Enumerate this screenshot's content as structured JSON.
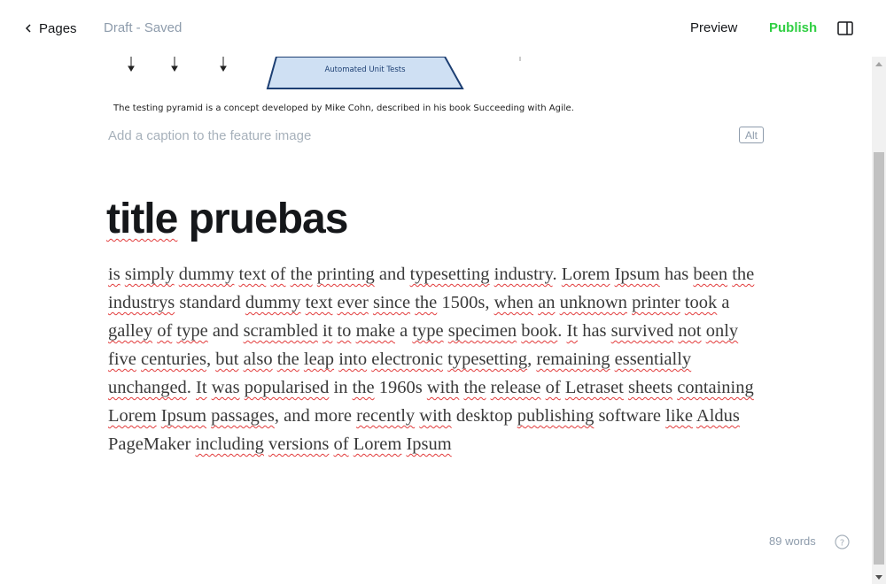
{
  "header": {
    "back_label": "Pages",
    "status": "Draft - Saved",
    "preview_label": "Preview",
    "publish_label": "Publish"
  },
  "feature_image": {
    "alt_text_image_box_label": "Automated Unit Tests",
    "caption_text": "The testing pyramid is a concept developed by Mike Cohn, described in his book Succeeding with Agile.",
    "caption_placeholder": "Add a caption to the feature image",
    "alt_label": "Alt"
  },
  "post": {
    "title_word": "title",
    "title_rest": " pruebas",
    "body_segments": [
      {
        "t": "is",
        "s": true
      },
      {
        "t": " "
      },
      {
        "t": "simply",
        "s": true
      },
      {
        "t": " "
      },
      {
        "t": "dummy",
        "s": true
      },
      {
        "t": " "
      },
      {
        "t": "text",
        "s": true
      },
      {
        "t": " "
      },
      {
        "t": "of",
        "s": true
      },
      {
        "t": " "
      },
      {
        "t": "the",
        "s": true
      },
      {
        "t": " "
      },
      {
        "t": "printing",
        "s": true
      },
      {
        "t": " and "
      },
      {
        "t": "typesetting",
        "s": true
      },
      {
        "t": " "
      },
      {
        "t": "industry",
        "s": true
      },
      {
        "t": ". "
      },
      {
        "t": "Lorem",
        "s": true
      },
      {
        "t": " "
      },
      {
        "t": "Ipsum",
        "s": true
      },
      {
        "t": " has "
      },
      {
        "t": "been",
        "s": true
      },
      {
        "t": " "
      },
      {
        "t": "the",
        "s": true
      },
      {
        "t": " "
      },
      {
        "t": "industrys",
        "s": true
      },
      {
        "t": " standard "
      },
      {
        "t": "dummy",
        "s": true
      },
      {
        "t": " "
      },
      {
        "t": "text",
        "s": true
      },
      {
        "t": " "
      },
      {
        "t": "ever",
        "s": true
      },
      {
        "t": " "
      },
      {
        "t": "since",
        "s": true
      },
      {
        "t": " "
      },
      {
        "t": "the",
        "s": true
      },
      {
        "t": " 1500s, "
      },
      {
        "t": "when",
        "s": true
      },
      {
        "t": " "
      },
      {
        "t": "an",
        "s": true
      },
      {
        "t": " "
      },
      {
        "t": "unknown",
        "s": true
      },
      {
        "t": " "
      },
      {
        "t": "printer",
        "s": true
      },
      {
        "t": " "
      },
      {
        "t": "took",
        "s": true
      },
      {
        "t": " a "
      },
      {
        "t": "galley",
        "s": true
      },
      {
        "t": " "
      },
      {
        "t": "of",
        "s": true
      },
      {
        "t": " "
      },
      {
        "t": "type",
        "s": true
      },
      {
        "t": " and "
      },
      {
        "t": "scrambled",
        "s": true
      },
      {
        "t": " "
      },
      {
        "t": "it",
        "s": true
      },
      {
        "t": " "
      },
      {
        "t": "to",
        "s": true
      },
      {
        "t": " "
      },
      {
        "t": "make",
        "s": true
      },
      {
        "t": " a "
      },
      {
        "t": "type",
        "s": true
      },
      {
        "t": " "
      },
      {
        "t": "specimen",
        "s": true
      },
      {
        "t": " "
      },
      {
        "t": "book",
        "s": true
      },
      {
        "t": ". "
      },
      {
        "t": "It",
        "s": true
      },
      {
        "t": " has "
      },
      {
        "t": "survived",
        "s": true
      },
      {
        "t": " "
      },
      {
        "t": "not",
        "s": true
      },
      {
        "t": " "
      },
      {
        "t": "only",
        "s": true
      },
      {
        "t": " "
      },
      {
        "t": "five",
        "s": true
      },
      {
        "t": " "
      },
      {
        "t": "centuries",
        "s": true
      },
      {
        "t": ", "
      },
      {
        "t": "but",
        "s": true
      },
      {
        "t": " "
      },
      {
        "t": "also",
        "s": true
      },
      {
        "t": " "
      },
      {
        "t": "the",
        "s": true
      },
      {
        "t": " "
      },
      {
        "t": "leap",
        "s": true
      },
      {
        "t": " "
      },
      {
        "t": "into",
        "s": true
      },
      {
        "t": " "
      },
      {
        "t": "electronic",
        "s": true
      },
      {
        "t": " "
      },
      {
        "t": "typesetting",
        "s": true
      },
      {
        "t": ", "
      },
      {
        "t": "remaining",
        "s": true
      },
      {
        "t": " "
      },
      {
        "t": "essentially",
        "s": true
      },
      {
        "t": " "
      },
      {
        "t": "unchanged",
        "s": true
      },
      {
        "t": ". "
      },
      {
        "t": "It",
        "s": true
      },
      {
        "t": " "
      },
      {
        "t": "was",
        "s": true
      },
      {
        "t": " "
      },
      {
        "t": "popularised",
        "s": true
      },
      {
        "t": " in "
      },
      {
        "t": "the",
        "s": true
      },
      {
        "t": " 1960s "
      },
      {
        "t": "with",
        "s": true
      },
      {
        "t": " "
      },
      {
        "t": "the",
        "s": true
      },
      {
        "t": " "
      },
      {
        "t": "release",
        "s": true
      },
      {
        "t": " "
      },
      {
        "t": "of",
        "s": true
      },
      {
        "t": " "
      },
      {
        "t": "Letraset",
        "s": true
      },
      {
        "t": " "
      },
      {
        "t": "sheets",
        "s": true
      },
      {
        "t": " "
      },
      {
        "t": "containing",
        "s": true
      },
      {
        "t": " "
      },
      {
        "t": "Lorem",
        "s": true
      },
      {
        "t": " "
      },
      {
        "t": "Ipsum",
        "s": true
      },
      {
        "t": " "
      },
      {
        "t": "passages",
        "s": true
      },
      {
        "t": ", and more "
      },
      {
        "t": "recently",
        "s": true
      },
      {
        "t": " "
      },
      {
        "t": "with",
        "s": true
      },
      {
        "t": " "
      },
      {
        "t": "desktop "
      },
      {
        "t": "publishing",
        "s": true
      },
      {
        "t": " software "
      },
      {
        "t": "like",
        "s": true
      },
      {
        "t": " "
      },
      {
        "t": "Aldus",
        "s": true
      },
      {
        "t": " PageMaker "
      },
      {
        "t": "including",
        "s": true
      },
      {
        "t": " "
      },
      {
        "t": "versions",
        "s": true
      },
      {
        "t": " "
      },
      {
        "t": "of",
        "s": true
      },
      {
        "t": " "
      },
      {
        "t": "Lorem",
        "s": true
      },
      {
        "t": " "
      },
      {
        "t": "Ipsum",
        "s": true
      }
    ]
  },
  "footer": {
    "word_count": "89 words"
  },
  "icons": {
    "back": "chevron-left-icon",
    "sidebar": "sidebar-toggle-icon",
    "help": "help-icon"
  },
  "colors": {
    "publish": "#30cf43",
    "muted": "#8e9cac",
    "text": "#15171a",
    "spellcheck": "#e23c3c"
  }
}
